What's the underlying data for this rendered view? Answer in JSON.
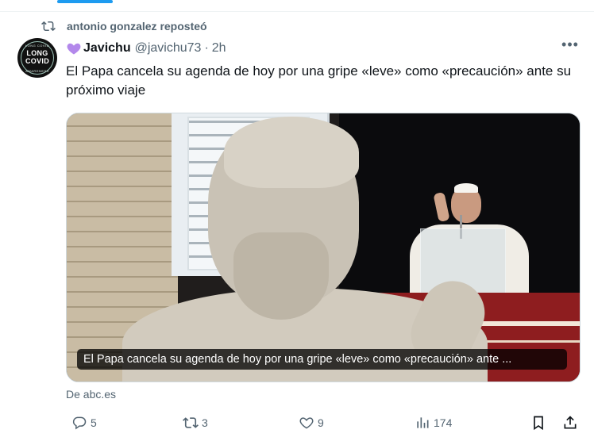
{
  "repost": {
    "label": "antonio gonzalez reposteó"
  },
  "avatar": {
    "line1": "LONG",
    "line2": "COVID",
    "top_small": "LONG COVID",
    "bottom_small": "AWARENESS"
  },
  "author": {
    "name": "Javichu",
    "handle": "@javichu73",
    "separator": "·",
    "time": "2h"
  },
  "more": {
    "label": "•••"
  },
  "tweet": {
    "text": "El Papa cancela su agenda de hoy por una gripe «leve» como «precaución» ante su próximo viaje"
  },
  "media": {
    "caption": "El Papa cancela su agenda de hoy por una gripe «leve» como «precaución» ante ..."
  },
  "source": {
    "label": "De abc.es"
  },
  "actions": {
    "reply_count": "5",
    "retweet_count": "3",
    "like_count": "9",
    "views_count": "174"
  },
  "colors": {
    "accent": "#1d9bf0",
    "secondary_text": "#536471",
    "heart_emoji": "#b388eb"
  },
  "icons": [
    "repost-icon",
    "purple-heart-icon",
    "more-icon",
    "reply-icon",
    "retweet-icon",
    "like-icon",
    "views-icon",
    "bookmark-icon",
    "share-icon"
  ]
}
